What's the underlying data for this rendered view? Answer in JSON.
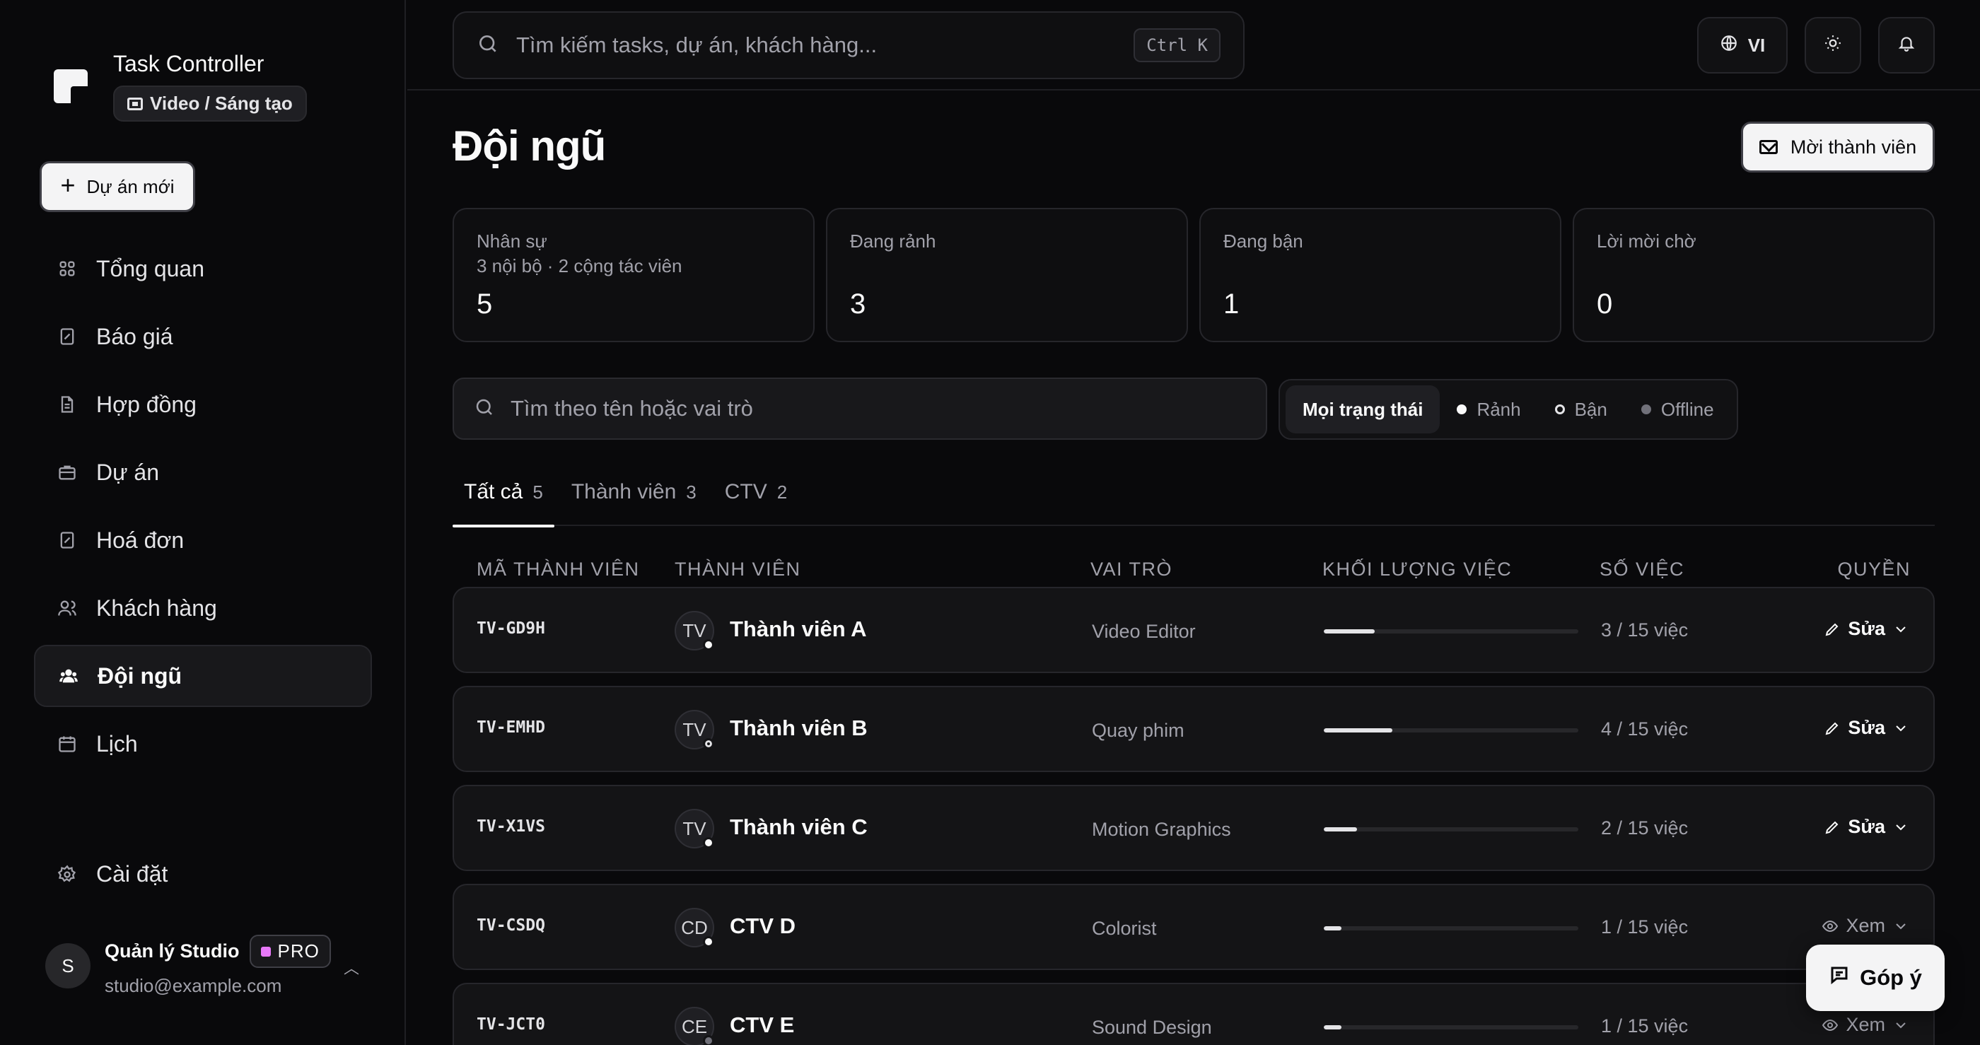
{
  "brand": {
    "name": "Task Controller",
    "workspace": "Video / Sáng tạo"
  },
  "sidebar": {
    "new_project": "Dự án mới",
    "items": [
      {
        "label": "Tổng quan",
        "icon": "grid-icon"
      },
      {
        "label": "Báo giá",
        "icon": "quote-icon"
      },
      {
        "label": "Hợp đồng",
        "icon": "document-icon"
      },
      {
        "label": "Dự án",
        "icon": "briefcase-icon"
      },
      {
        "label": "Hoá đơn",
        "icon": "invoice-icon"
      },
      {
        "label": "Khách hàng",
        "icon": "users-icon"
      },
      {
        "label": "Đội ngũ",
        "icon": "team-icon",
        "active": true
      },
      {
        "label": "Lịch",
        "icon": "calendar-icon"
      }
    ],
    "settings": "Cài đặt",
    "user": {
      "initial": "S",
      "name": "Quản lý Studio",
      "plan": "PRO",
      "email": "studio@example.com"
    }
  },
  "topbar": {
    "search_placeholder": "Tìm kiếm tasks, dự án, khách hàng...",
    "shortcut": "Ctrl K",
    "language": "VI"
  },
  "page": {
    "title": "Đội ngũ",
    "invite_label": "Mời thành viên"
  },
  "stats": [
    {
      "label": "Nhân sự",
      "sub": "3 nội bộ · 2 cộng tác viên",
      "value": "5"
    },
    {
      "label": "Đang rảnh",
      "sub": "",
      "value": "3"
    },
    {
      "label": "Đang bận",
      "sub": "",
      "value": "1"
    },
    {
      "label": "Lời mời chờ",
      "sub": "",
      "value": "0"
    }
  ],
  "filters": {
    "search_placeholder": "Tìm theo tên hoặc vai trò",
    "status": [
      "Mọi trạng thái",
      "Rảnh",
      "Bận",
      "Offline"
    ]
  },
  "tabs": [
    {
      "label": "Tất cả",
      "count": "5"
    },
    {
      "label": "Thành viên",
      "count": "3"
    },
    {
      "label": "CTV",
      "count": "2"
    }
  ],
  "table": {
    "headers": [
      "MÃ THÀNH VIÊN",
      "THÀNH VIÊN",
      "VAI TRÒ",
      "KHỐI LƯỢNG VIỆC",
      "SỐ VIỆC",
      "QUYỀN"
    ],
    "rows": [
      {
        "id": "TV-GD9H",
        "initials": "TV",
        "name": "Thành viên A",
        "status": "free",
        "role": "Video Editor",
        "load": 0.2,
        "count": "3 / 15 việc",
        "perm": "Sửa",
        "perm_type": "edit"
      },
      {
        "id": "TV-EMHD",
        "initials": "TV",
        "name": "Thành viên B",
        "status": "busy",
        "role": "Quay phim",
        "load": 0.27,
        "count": "4 / 15 việc",
        "perm": "Sửa",
        "perm_type": "edit"
      },
      {
        "id": "TV-X1VS",
        "initials": "TV",
        "name": "Thành viên C",
        "status": "free",
        "role": "Motion Graphics",
        "load": 0.13,
        "count": "2 / 15 việc",
        "perm": "Sửa",
        "perm_type": "edit"
      },
      {
        "id": "TV-CSDQ",
        "initials": "CD",
        "name": "CTV D",
        "status": "free",
        "role": "Colorist",
        "load": 0.07,
        "count": "1 / 15 việc",
        "perm": "Xem",
        "perm_type": "view"
      },
      {
        "id": "TV-JCT0",
        "initials": "CE",
        "name": "CTV E",
        "status": "off",
        "role": "Sound Design",
        "load": 0.07,
        "count": "1 / 15 việc",
        "perm": "Xem",
        "perm_type": "view"
      }
    ]
  },
  "feedback_label": "Góp ý"
}
